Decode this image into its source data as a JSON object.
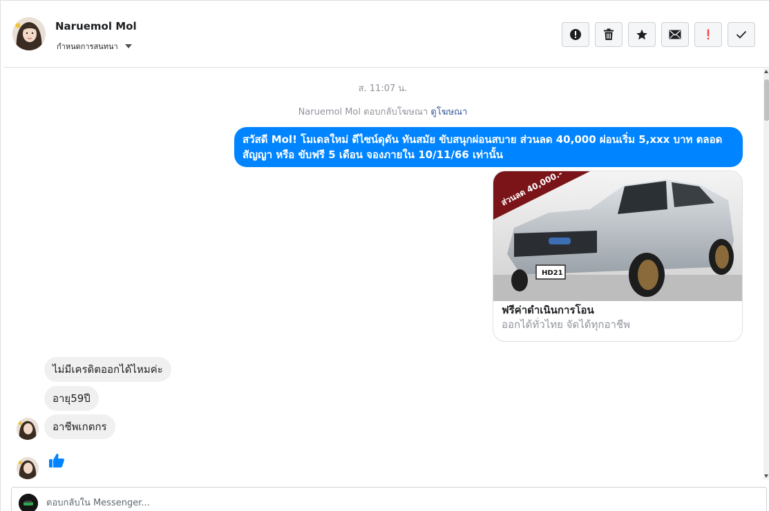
{
  "header": {
    "contact_name": "Naruemol Mol",
    "conversation_label": "กำหนดการสนทนา",
    "actions": [
      {
        "name": "report-spam-button",
        "icon": "exclamation-circle-icon",
        "color": "#1c1e21"
      },
      {
        "name": "delete-button",
        "icon": "trash-icon",
        "color": "#1c1e21"
      },
      {
        "name": "star-button",
        "icon": "star-icon",
        "color": "#1c1e21"
      },
      {
        "name": "mark-unread-button",
        "icon": "envelope-icon",
        "color": "#1c1e21"
      },
      {
        "name": "follow-up-button",
        "icon": "exclamation-icon",
        "color": "#fa3e3e"
      },
      {
        "name": "mark-done-button",
        "icon": "check-icon",
        "color": "#1c1e21"
      }
    ]
  },
  "conversation": {
    "timestamp": "ส. 11:07 น.",
    "reply_notice_prefix": "Naruemol Mol ตอบกลับโฆษณา",
    "reply_notice_link": "ดูโฆษณา",
    "outgoing_message": "สวัสดี Mol!  โมเดลใหม่ ดีไซน์ดุดัน ทันสมัย ขับสนุกผ่อนสบาย ส่วนลด 40,000 ผ่อนเริ่ม 5,xxx บาท ตลอดสัญญา หรือ ขับฟรี 5 เดือน จองภายใน 10/11/66 เท่านั้น",
    "ad_card": {
      "title": "ฟรีค่าดำเนินการโอน",
      "subtitle": "ออกได้ทั่วไทย จัดได้ทุกอาชีพ",
      "banner_text": "ส่วนลด 40,000.-",
      "plate_text": "HD21"
    },
    "incoming_messages": [
      {
        "text": "ไม่มีเครดิตออกได้ไหมค่ะ"
      },
      {
        "text": "อายุ59ปี"
      },
      {
        "text": "อาชีพเกตกร"
      }
    ],
    "like_icon": "thumbs-up-icon",
    "accent_color": "#0084ff"
  },
  "composer": {
    "placeholder": "ตอบกลับใน Messenger..."
  }
}
